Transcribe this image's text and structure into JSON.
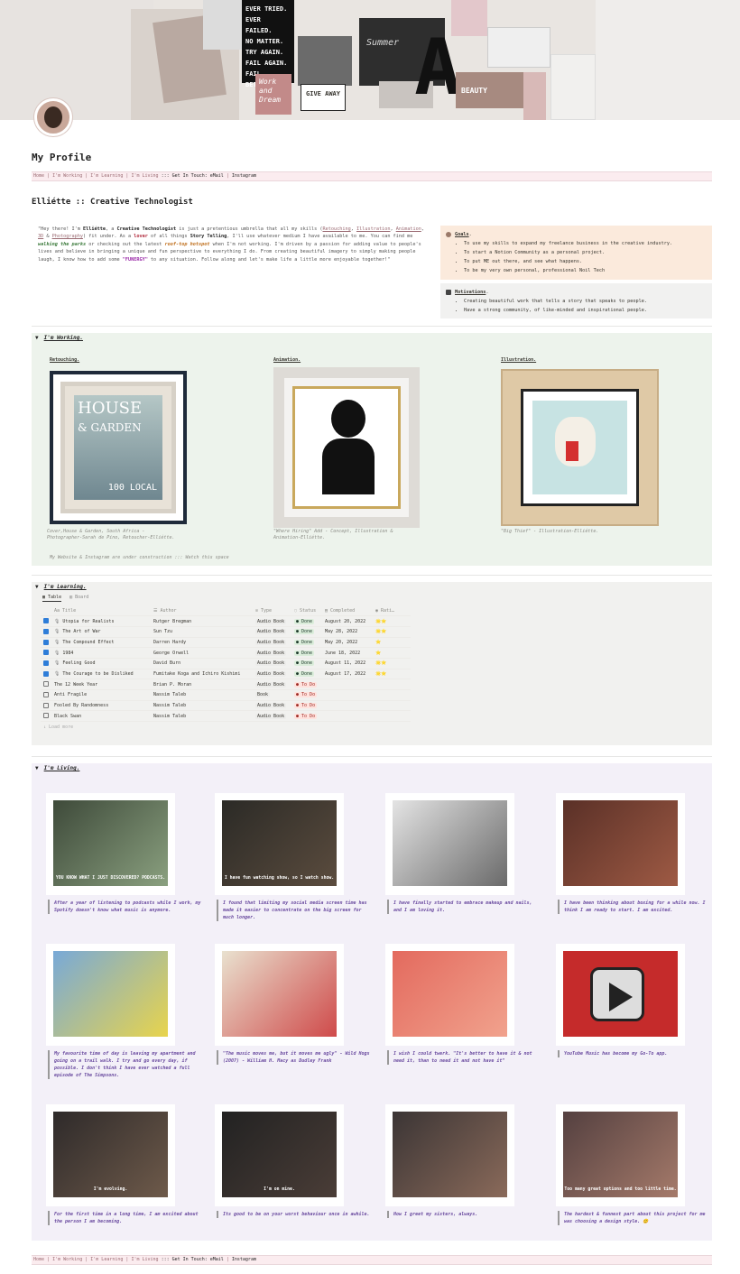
{
  "cover_text": {
    "quote_lines": [
      "EVER TRIED.",
      "EVER FAILED.",
      "NO MATTER.",
      "TRY AGAIN.",
      "FAIL AGAIN.",
      "FAIL BETTER."
    ],
    "summer": "Summer",
    "letter": "A",
    "beauty": "BEAUTY",
    "give": "GIVE AWAY",
    "work": "Work and Dream"
  },
  "page": {
    "title": "My Profile",
    "subtitle": "Elliétte :: Creative Technologist"
  },
  "nav": {
    "home": "Home",
    "sep": "|",
    "working": "I'm Working",
    "learning": "I'm Learning",
    "living": "I'm Living",
    "touch": "::: Get In Touch:",
    "email": "eMail",
    "instagram": "Instagram"
  },
  "intro": {
    "p1": "\"Hey there! I'm ",
    "name": "Elliétte",
    "p2": ", a ",
    "role": "Creative Technologist",
    "p3": " is just a pretentious umbrella that all my skills (",
    "s1": "Retouching",
    "s2": "Illustration",
    "s3": "Animation",
    "s4": "3D",
    "s5": "Photography",
    "p4": ") fit under. As a ",
    "lover": "lover",
    "p5": " of all things ",
    "story": "Story Telling",
    "p6": ", I'll use whatever medium I have available to me. You can find me ",
    "walking": "walking the parks",
    "p7": " or checking out the latest ",
    "roof": "roof-top hotspot",
    "p8": " when I'm not working. I'm driven by a passion for adding value to people's lives and believe in bringing a unique and fun perspective to everything I do. From creating beautiful imagery to simply making people laugh, I know how to add some ",
    "funergy": "\"FUNERGY\"",
    "p9": " to any situation. Follow along and let's make life a little more enjoyable together!\""
  },
  "goals": {
    "title": "Goals",
    "items": [
      "To use my skills to expand my freelance business in the creative industry.",
      "To start a Notion Community as a personal project.",
      "To put ME out there, and see what happens.",
      "To be my very own personal, professional Noil Tech"
    ]
  },
  "motivations": {
    "title": "Motivations",
    "items": [
      "Creating beautiful work that tells a story that speaks to people.",
      "Have a strong community, of like-minded and inspirational people."
    ]
  },
  "working": {
    "title": "I'm Working.",
    "cols": [
      {
        "title": "Retouching.",
        "caption1": "Cover,House & Garden, South Africa -",
        "caption2": "Photographer-Sarah de Pino, Retoucher-Elliétte."
      },
      {
        "title": "Animation.",
        "caption1": "\"Where Hiring\" Add - Concept, Illustration &",
        "caption2": "Animation-Elliétte."
      },
      {
        "title": "Illustration.",
        "caption1": "\"Big Thief\" - Illustration-Elliétte.",
        "caption2": ""
      }
    ],
    "magazine": {
      "house": "HOUSE",
      "garden": "& GARDEN",
      "big": "100 LOCAL"
    },
    "note": "My Website & Instagram are under construction ::: Watch this space"
  },
  "learning": {
    "title": "I'm Learning.",
    "views": {
      "table": "Table",
      "board": "Board"
    },
    "headers": [
      "Title",
      "Author",
      "Type",
      "Status",
      "Completed",
      "Rati…"
    ],
    "rows": [
      {
        "check": true,
        "title": "Utopia for Realists",
        "author": "Rutger Bregman",
        "type": "Audio Book",
        "status": "Done",
        "completed": "August 20, 2022",
        "rating": "🌟⭐"
      },
      {
        "check": true,
        "title": "The Art of War",
        "author": "Sun Tzu",
        "type": "Audio Book",
        "status": "Done",
        "completed": "May 28, 2022",
        "rating": "🌟⭐"
      },
      {
        "check": true,
        "title": "The Compound Effect",
        "author": "Darren Hardy",
        "type": "Audio Book",
        "status": "Done",
        "completed": "May 20, 2022",
        "rating": "⭐"
      },
      {
        "check": true,
        "title": "1984",
        "author": "George Orwell",
        "type": "Audio Book",
        "status": "Done",
        "completed": "June 18, 2022",
        "rating": "⭐"
      },
      {
        "check": true,
        "title": "Feeling Good",
        "author": "David Burn",
        "type": "Audio Book",
        "status": "Done",
        "completed": "August 11, 2022",
        "rating": "🌟⭐"
      },
      {
        "check": true,
        "title": "The Courage to be Disliked",
        "author": "Fumitake Koga and Ichiro Kishimi",
        "type": "Audio Book",
        "status": "Done",
        "completed": "August 17, 2022",
        "rating": "🌟⭐"
      },
      {
        "check": false,
        "title": "The 12 Week Year",
        "author": "Brian P. Moran",
        "type": "Audio Book",
        "status": "To Do",
        "completed": "",
        "rating": ""
      },
      {
        "check": false,
        "title": "Anti Fragile",
        "author": "Nassim Taleb",
        "type": "Book",
        "status": "To Do",
        "completed": "",
        "rating": ""
      },
      {
        "check": false,
        "title": "Fooled By Randomness",
        "author": "Nassim Taleb",
        "type": "Audio Book",
        "status": "To Do",
        "completed": "",
        "rating": ""
      },
      {
        "check": false,
        "title": "Black Swan",
        "author": "Nassim Taleb",
        "type": "Audio Book",
        "status": "To Do",
        "completed": "",
        "rating": ""
      }
    ],
    "load_more": "↓ Load more"
  },
  "living": {
    "title": "I'm Living.",
    "gifs": [
      {
        "subtitle": "YOU KNOW WHAT I JUST DISCOVERED? PODCASTS.",
        "caption": "After a year of listening to podcasts while I work, my Spotify doesn't know what music is anymore."
      },
      {
        "subtitle": "I have fun watching show, so I watch show.",
        "caption": "I found that limiting my social media screen time has made it easier to concentrate on the big screen for much longer."
      },
      {
        "subtitle": "",
        "caption": "I have finally started to embrace makeup and nails, and I am loving it."
      },
      {
        "subtitle": "",
        "caption": "I have been thinking about boxing for a while now. I think I am ready to start. I am excited."
      },
      {
        "subtitle": "",
        "caption": "My favourite time of day is leaving my apartment and going on a trail walk. I try and go every day, if possible. I don't think I have ever watched a full episode of The Simpsons."
      },
      {
        "subtitle": "",
        "caption": "\"The music moves me, but it moves me ugly\" - Wild Hogs (2007) - William H. Macy as Dudley Frank"
      },
      {
        "subtitle": "",
        "caption": "I wish I could twerk. \"It's better to have it & not need it, than to need it and not have it\""
      },
      {
        "subtitle": "",
        "caption": "YouTube Music has become my Go-To app."
      },
      {
        "subtitle": "I'm evolving.",
        "caption": "For the first time in a long time, I am excited about the person I am becoming."
      },
      {
        "subtitle": "I'm on mine.",
        "caption": "Its good to be on your worst behaviour once in awhile."
      },
      {
        "subtitle": "",
        "caption": "How I greet my sisters, always."
      },
      {
        "subtitle": "Too many great options and too little time.",
        "caption": "The hardest & funnest part about this project for me was choosing a design style. 😊"
      }
    ]
  }
}
